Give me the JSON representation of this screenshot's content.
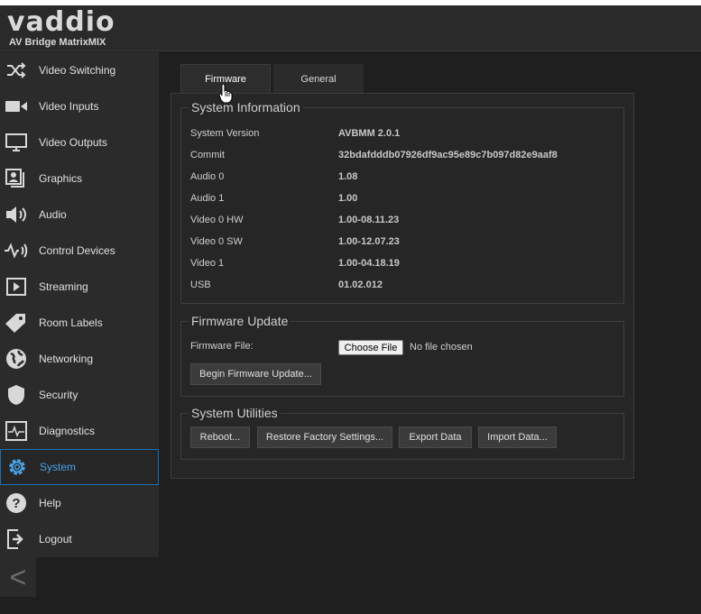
{
  "brand": {
    "logo": "vaddio",
    "product": "AV Bridge MatrixMIX"
  },
  "sidebar": {
    "items": [
      {
        "label": "Video Switching",
        "icon": "shuffle-icon"
      },
      {
        "label": "Video Inputs",
        "icon": "camera-icon"
      },
      {
        "label": "Video Outputs",
        "icon": "monitor-icon"
      },
      {
        "label": "Graphics",
        "icon": "graphics-icon"
      },
      {
        "label": "Audio",
        "icon": "speaker-icon"
      },
      {
        "label": "Control Devices",
        "icon": "control-signal-icon"
      },
      {
        "label": "Streaming",
        "icon": "play-icon"
      },
      {
        "label": "Room Labels",
        "icon": "tag-icon"
      },
      {
        "label": "Networking",
        "icon": "globe-icon"
      },
      {
        "label": "Security",
        "icon": "shield-icon"
      },
      {
        "label": "Diagnostics",
        "icon": "pulse-icon"
      },
      {
        "label": "System",
        "icon": "gear-icon"
      },
      {
        "label": "Help",
        "icon": "help-icon"
      },
      {
        "label": "Logout",
        "icon": "logout-icon"
      }
    ],
    "active": "System",
    "collapse_glyph": "<"
  },
  "tabs": [
    {
      "label": "Firmware",
      "active": true
    },
    {
      "label": "General",
      "active": false
    }
  ],
  "system_information": {
    "title": "System Information",
    "rows": [
      {
        "label": "System Version",
        "value": "AVBMM 2.0.1"
      },
      {
        "label": "Commit",
        "value": "32bdafdddb07926df9ac95e89c7b097d82e9aaf8"
      },
      {
        "label": "Audio 0",
        "value": "1.08"
      },
      {
        "label": "Audio 1",
        "value": "1.00"
      },
      {
        "label": "Video 0 HW",
        "value": "1.00-08.11.23"
      },
      {
        "label": "Video 0 SW",
        "value": "1.00-12.07.23"
      },
      {
        "label": "Video 1",
        "value": "1.00-04.18.19"
      },
      {
        "label": "USB",
        "value": "01.02.012"
      }
    ]
  },
  "firmware_update": {
    "title": "Firmware Update",
    "file_label": "Firmware File:",
    "choose_button": "Choose File",
    "file_status": "No file chosen",
    "begin_button": "Begin Firmware Update..."
  },
  "system_utilities": {
    "title": "System Utilities",
    "buttons": [
      "Reboot...",
      "Restore Factory Settings...",
      "Export Data",
      "Import Data..."
    ]
  },
  "colors": {
    "accent": "#4aa3e8",
    "active_border": "#1b6fb4",
    "background": "#1f1f1f"
  }
}
